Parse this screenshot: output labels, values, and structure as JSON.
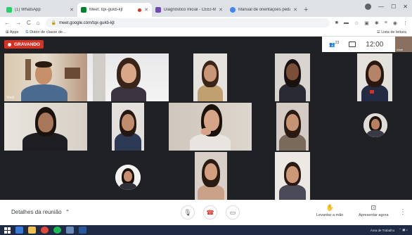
{
  "browser": {
    "tabs": [
      {
        "title": "(1) WhatsApp",
        "favicon_color": "#25d366",
        "active": false
      },
      {
        "title": "Meet: tqx-gukb-kjt",
        "favicon_color": "#00832d",
        "active": true
      },
      {
        "title": "Diagnóstico Inicial - CEEI-MCAS",
        "favicon_color": "#7248b9",
        "active": false
      },
      {
        "title": "Manual de orientações pedagó",
        "favicon_color": "#4285f4",
        "active": false
      }
    ],
    "url": "meet.google.com/tqx-gukb-kjt",
    "bookmarks": {
      "apps": "Apps",
      "diario": "Diário de classe de...",
      "reading_list": "Lista de leitura"
    }
  },
  "meet": {
    "recording_label": "GRAVANDO",
    "participants_count": "23",
    "clock": "12:00",
    "self_label": "Você",
    "self_tile_label": "Você",
    "meeting_details": "Detalhes da reunião",
    "raise_hand": "Levantar a mão",
    "present_now": "Apresentar agora",
    "accent_red": "#d93025"
  },
  "taskbar": {
    "tray_text": "Área de Trabalho"
  }
}
